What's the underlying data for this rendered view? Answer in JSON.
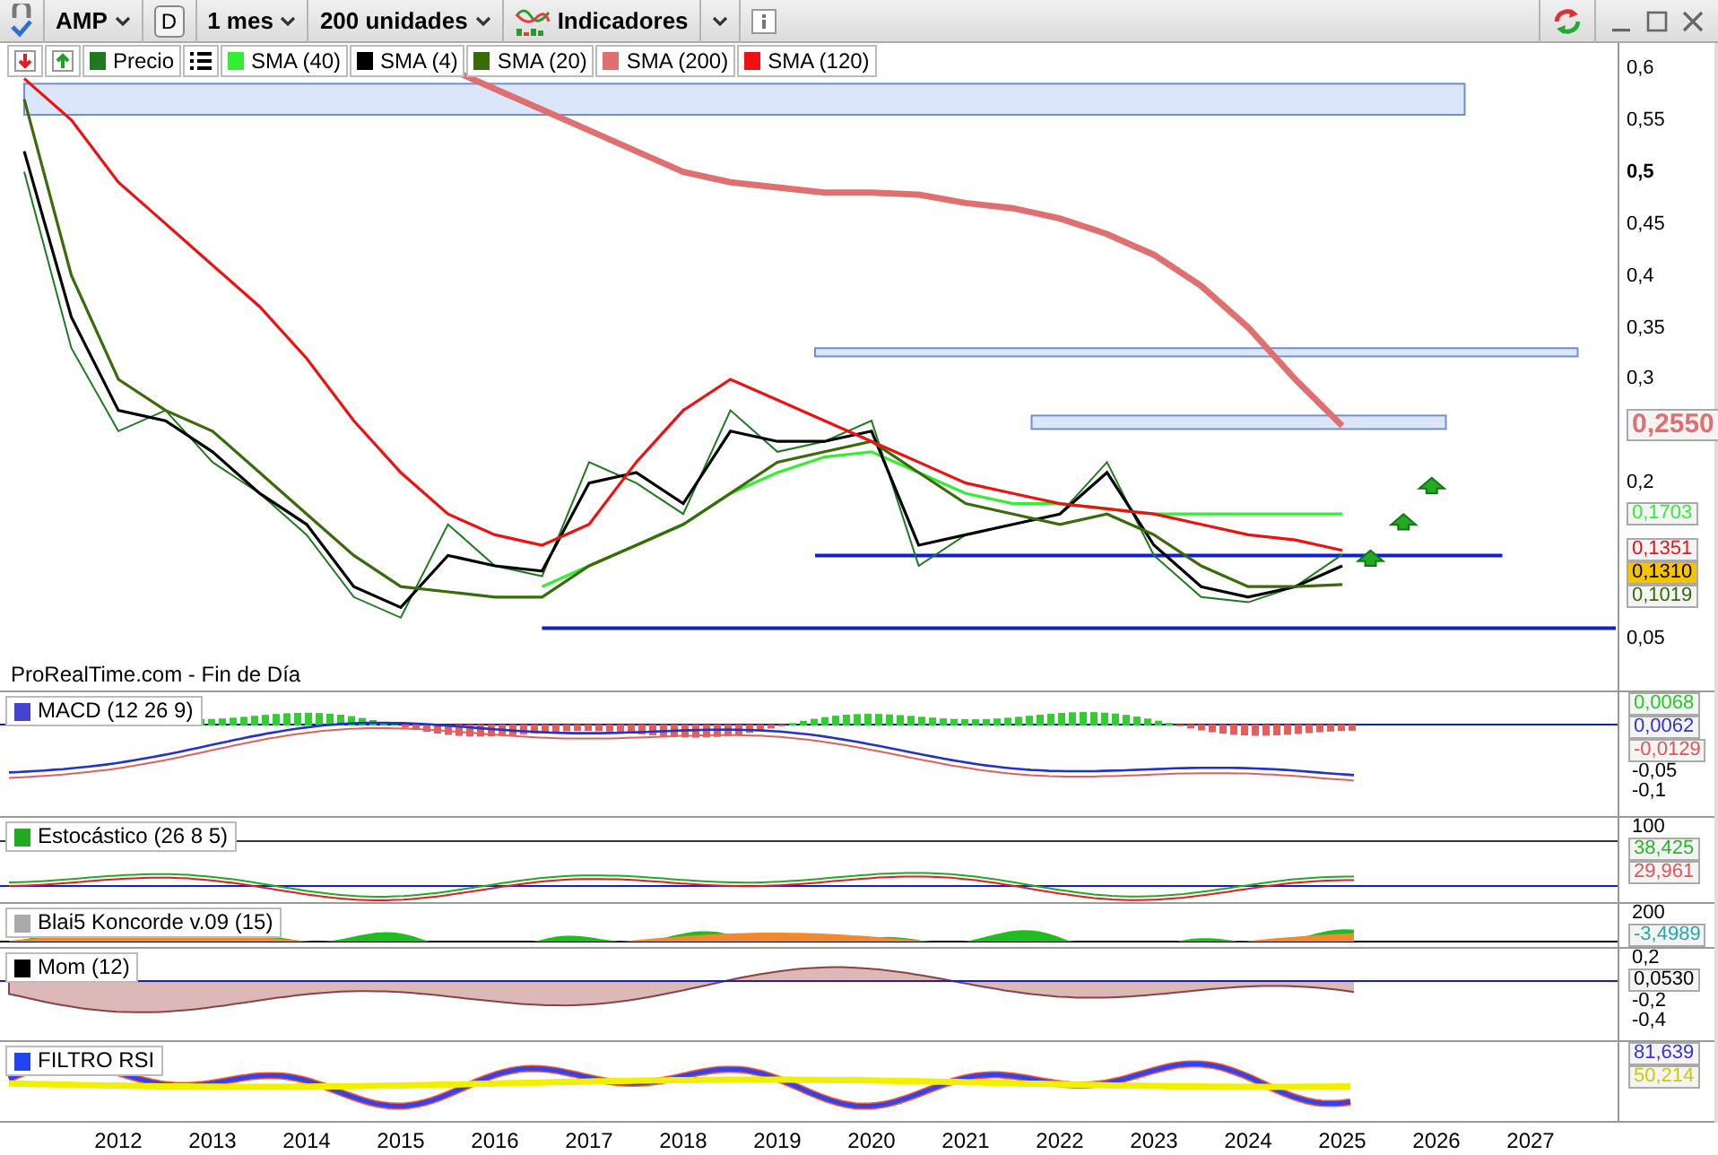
{
  "toolbar": {
    "symbol": "AMP",
    "period_button": "D",
    "timeframe": "1 mes",
    "units": "200 unidades",
    "indicators": "Indicadores"
  },
  "main_chart": {
    "source": "ProRealTime.com - Fin de Día",
    "legend": [
      {
        "name": "Precio",
        "color": "#1f7a1f"
      },
      {
        "name": "SMA (40)",
        "color": "#33ee33"
      },
      {
        "name": "SMA (4)",
        "color": "#000000"
      },
      {
        "name": "SMA (20)",
        "color": "#3a6b0a"
      },
      {
        "name": "SMA (200)",
        "color": "#e07070"
      },
      {
        "name": "SMA (120)",
        "color": "#ee1111"
      }
    ],
    "y_axis": [
      "0,6",
      "0,55",
      "0,5",
      "0,45",
      "0,4",
      "0,35",
      "0,3",
      "0,2",
      "0,05"
    ],
    "price_labels": [
      {
        "text": "0,2550",
        "color": "#e07070",
        "kind": "large"
      },
      {
        "text": "0,1703",
        "color": "#33ee33",
        "kind": "plain"
      },
      {
        "text": "0,1351",
        "color": "#ee1111",
        "kind": "plain"
      },
      {
        "text": "0,1310",
        "color": "#f5c400",
        "kind": "highlighted"
      },
      {
        "text": "0,1019",
        "color": "#3a6b0a",
        "kind": "plain"
      }
    ]
  },
  "panels": [
    {
      "title": "MACD (12 26 9)",
      "kind": "macd",
      "color": "#4444cc",
      "axis": [
        {
          "kind": "reading",
          "text": "0,0068",
          "color": "#22cc22"
        },
        {
          "kind": "reading",
          "text": "0,0062",
          "color": "#3333dd"
        },
        {
          "kind": "reading",
          "text": "-0,0129",
          "color": "#e05555"
        },
        {
          "kind": "tick",
          "text": "-0,05"
        },
        {
          "kind": "tick",
          "text": "-0,1"
        }
      ]
    },
    {
      "title": "Estocástico (26 8 5)",
      "kind": "stochastic",
      "color": "#22aa22",
      "axis": [
        {
          "kind": "tick",
          "text": "100"
        },
        {
          "kind": "reading",
          "text": "38,425",
          "color": "#22bb22"
        },
        {
          "kind": "reading",
          "text": "29,961",
          "color": "#e05555"
        }
      ]
    },
    {
      "title": "Blai5 Koncorde v.09 (15)",
      "kind": "koncorde",
      "color": "#aaaaaa",
      "axis": [
        {
          "kind": "tick",
          "text": "200"
        },
        {
          "kind": "reading",
          "text": "-3,4989",
          "color": "#22aaaa"
        }
      ]
    },
    {
      "title": "Mom (12)",
      "kind": "momentum",
      "color": "#000000",
      "axis": [
        {
          "kind": "tick",
          "text": "0,2"
        },
        {
          "kind": "reading",
          "text": "0,0530",
          "color": "#000000"
        },
        {
          "kind": "tick",
          "text": "-0,2"
        },
        {
          "kind": "tick",
          "text": "-0,4"
        }
      ]
    },
    {
      "title": "FILTRO RSI",
      "kind": "rsi",
      "color": "#2244ee",
      "axis": [
        {
          "kind": "reading",
          "text": "81,639",
          "color": "#3333dd"
        },
        {
          "kind": "reading",
          "text": "50,214",
          "color": "#cccc00"
        }
      ]
    }
  ],
  "time_axis": [
    "2012",
    "2013",
    "2014",
    "2015",
    "2016",
    "2017",
    "2018",
    "2019",
    "2020",
    "2021",
    "2022",
    "2023",
    "2024",
    "2025",
    "2026",
    "2027"
  ]
}
